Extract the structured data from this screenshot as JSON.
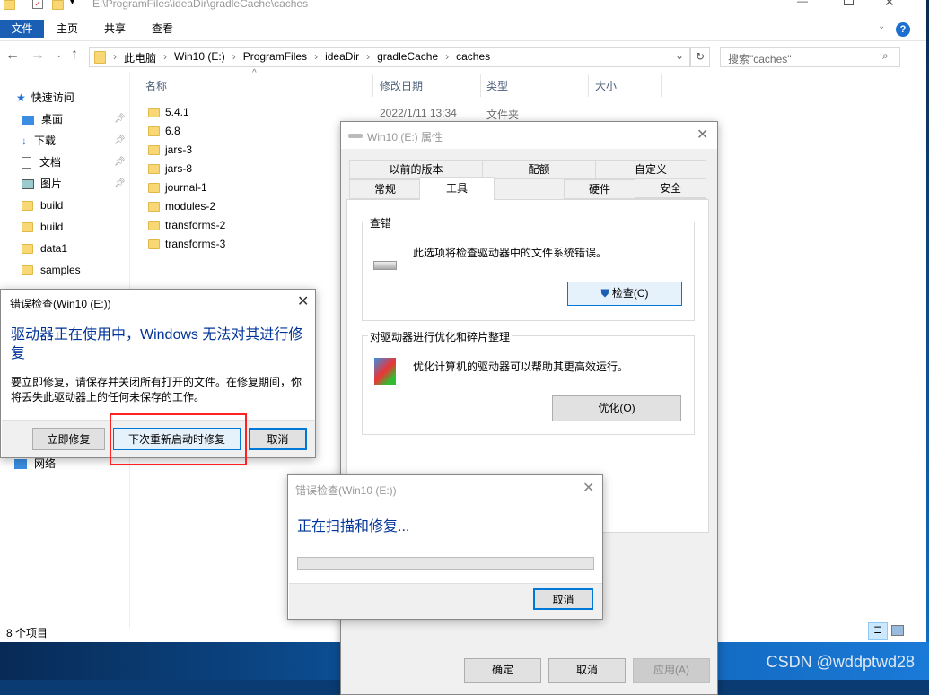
{
  "explorer": {
    "title_path": "E:\\ProgramFiles\\ideaDir\\gradleCache\\caches",
    "ribbon_tabs": [
      "文件",
      "主页",
      "共享",
      "查看"
    ],
    "breadcrumb": [
      "此电脑",
      "Win10 (E:)",
      "ProgramFiles",
      "ideaDir",
      "gradleCache",
      "caches"
    ],
    "search_placeholder": "搜索\"caches\"",
    "columns": [
      "名称",
      "修改日期",
      "类型",
      "大小"
    ],
    "nav": [
      {
        "label": "快速访问",
        "icon": "star-icon"
      },
      {
        "label": "桌面",
        "icon": "desktop-icon",
        "pinned": true
      },
      {
        "label": "下载",
        "icon": "download-icon",
        "pinned": true
      },
      {
        "label": "文档",
        "icon": "document-icon",
        "pinned": true
      },
      {
        "label": "图片",
        "icon": "picture-icon",
        "pinned": true
      },
      {
        "label": "build",
        "icon": "folder-icon"
      },
      {
        "label": "build",
        "icon": "folder-icon"
      },
      {
        "label": "data1",
        "icon": "folder-icon"
      },
      {
        "label": "samples",
        "icon": "folder-icon"
      },
      {
        "label": "网络",
        "icon": "network-icon"
      }
    ],
    "files": [
      {
        "name": "5.4.1",
        "date": "2022/1/11 13:34",
        "type": "文件夹"
      },
      {
        "name": "6.8"
      },
      {
        "name": "jars-3"
      },
      {
        "name": "jars-8"
      },
      {
        "name": "journal-1"
      },
      {
        "name": "modules-2"
      },
      {
        "name": "transforms-2"
      },
      {
        "name": "transforms-3"
      }
    ],
    "status": "8 个项目"
  },
  "props": {
    "title": "Win10 (E:) 属性",
    "tabs_row1": [
      "以前的版本",
      "配额",
      "自定义"
    ],
    "tabs_row2": [
      "常规",
      "工具",
      "硬件",
      "共享",
      "安全"
    ],
    "active_tab": "工具",
    "check_group": "查错",
    "check_text": "此选项将检查驱动器中的文件系统错误。",
    "check_button": "检查(C)",
    "opt_group": "对驱动器进行优化和碎片整理",
    "opt_text": "优化计算机的驱动器可以帮助其更高效运行。",
    "opt_button": "优化(O)",
    "ok": "确定",
    "cancel": "取消",
    "apply": "应用(A)"
  },
  "err1": {
    "title": "错误检查(Win10 (E:))",
    "heading": "驱动器正在使用中，Windows 无法对其进行修复",
    "body": "要立即修复，请保存并关闭所有打开的文件。在修复期间，你将丢失此驱动器上的任何未保存的工作。",
    "repair_now": "立即修复",
    "repair_restart": "下次重新启动时修复",
    "cancel": "取消"
  },
  "err2": {
    "title": "错误检查(Win10 (E:))",
    "heading": "正在扫描和修复...",
    "progress": 0,
    "cancel": "取消"
  },
  "watermark": "CSDN @wddptwd28",
  "colors": {
    "accent": "#0078d7",
    "heading_blue": "#003399",
    "highlight": "#ff2020"
  }
}
